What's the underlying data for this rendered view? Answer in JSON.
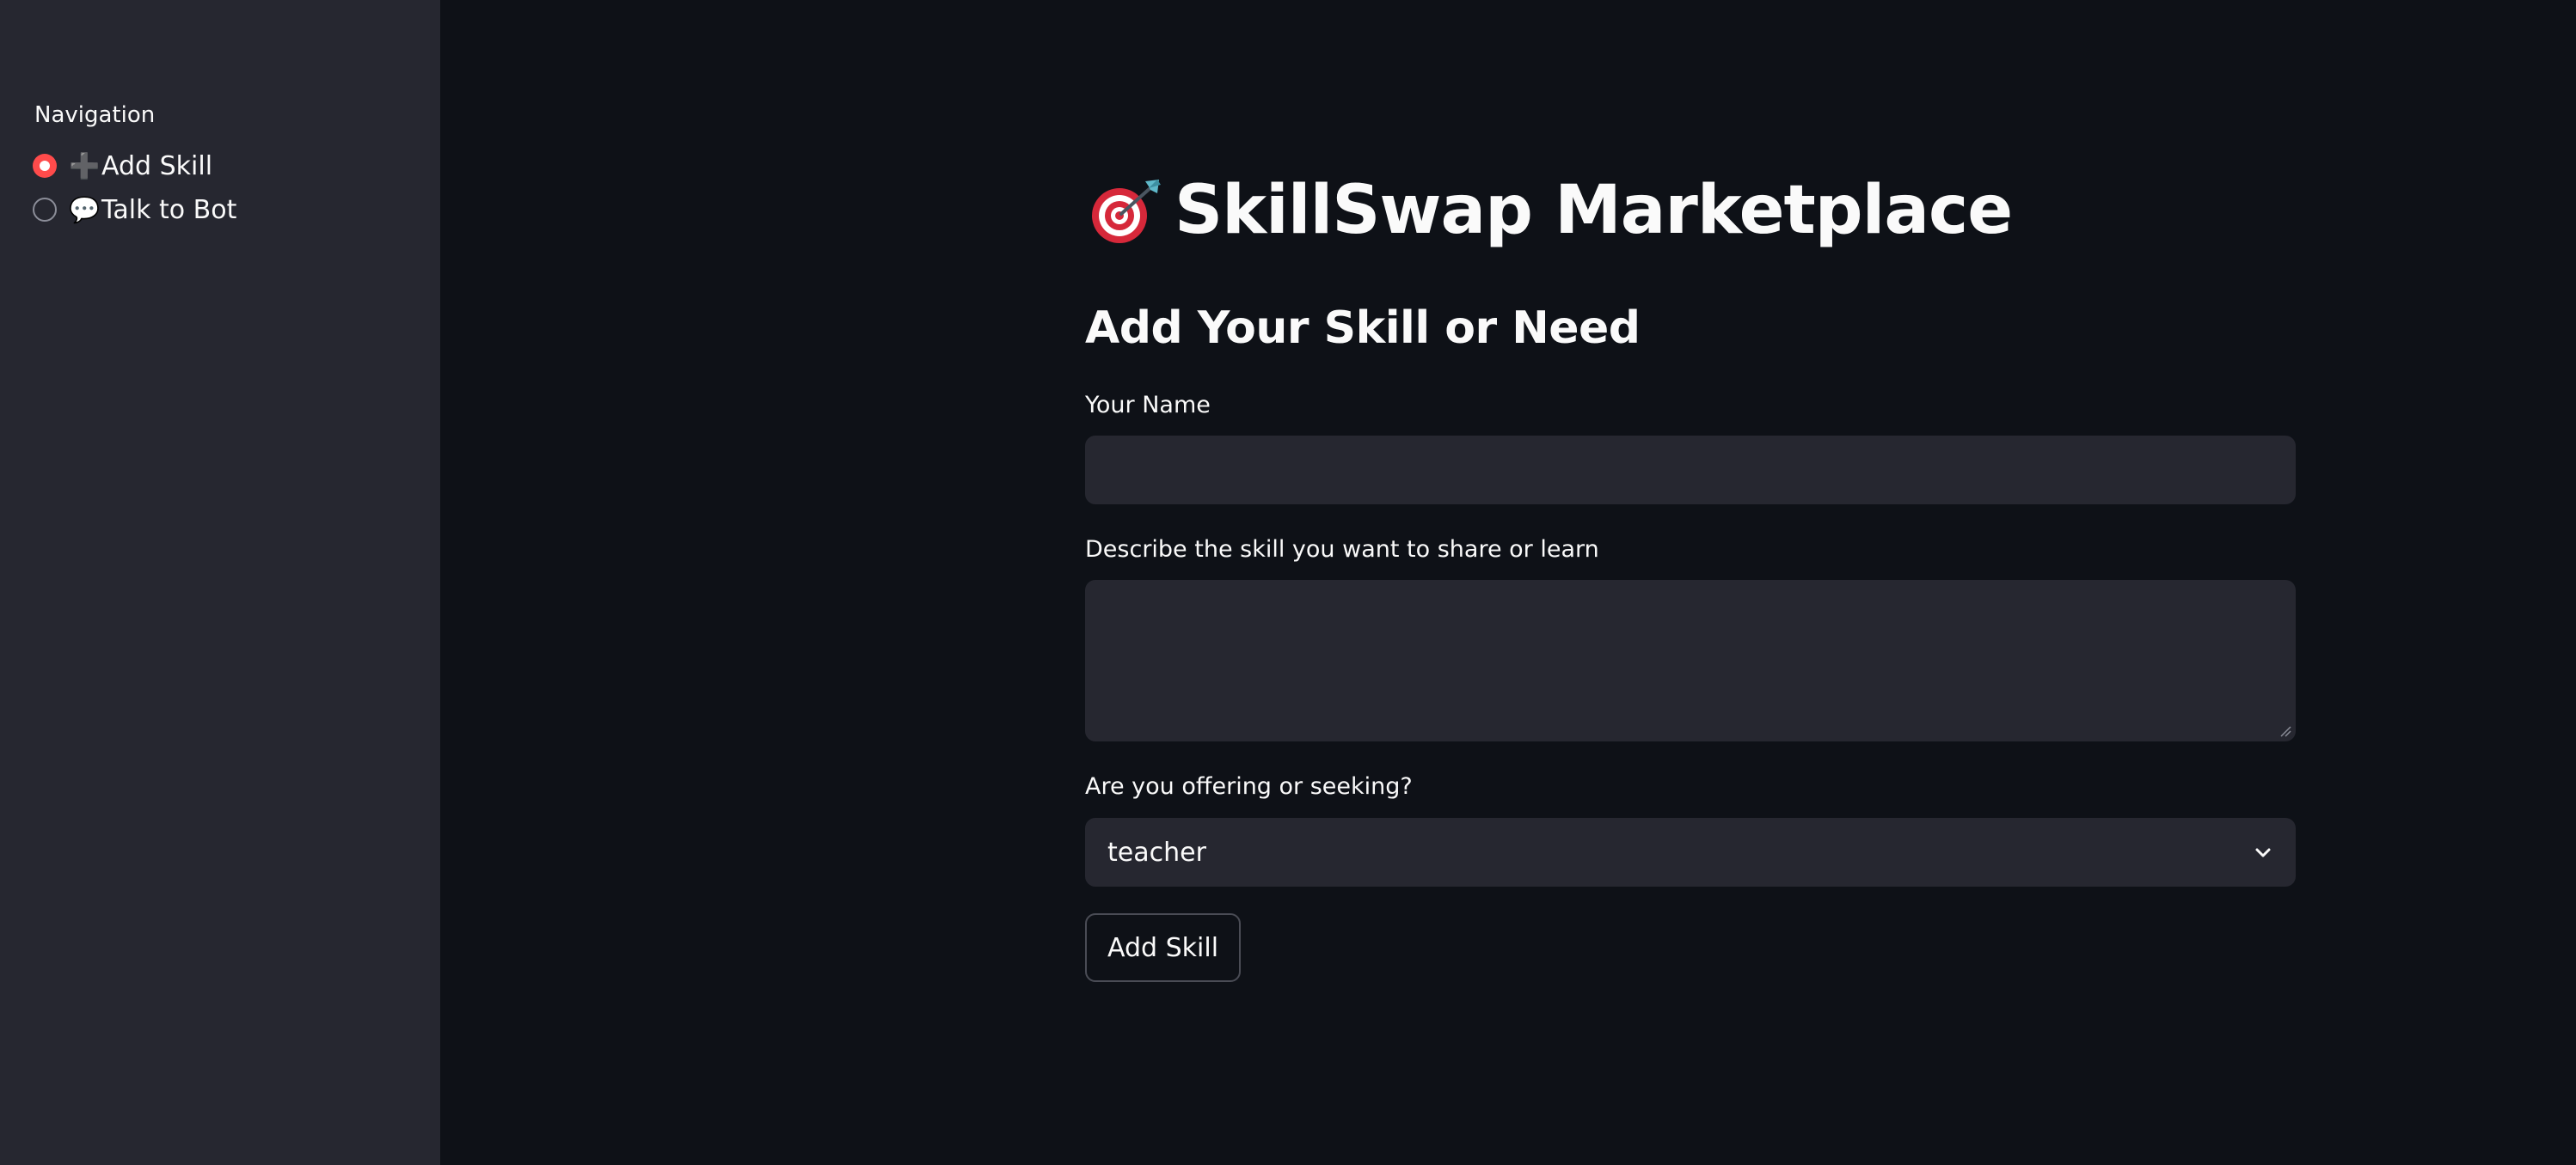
{
  "sidebar": {
    "heading": "Navigation",
    "items": [
      {
        "emoji": "➕",
        "label": "Add Skill",
        "selected": true
      },
      {
        "emoji": "💬",
        "label": "Talk to Bot",
        "selected": false
      }
    ]
  },
  "main": {
    "title": "SkillSwap Marketplace",
    "title_icon": "direct-hit-target-icon",
    "subheader": "Add Your Skill or Need",
    "name_field": {
      "label": "Your Name",
      "value": ""
    },
    "skill_field": {
      "label": "Describe the skill you want to share or learn",
      "value": ""
    },
    "role_select": {
      "label": "Are you offering or seeking?",
      "value": "teacher"
    },
    "submit_button": "Add Skill"
  },
  "colors": {
    "app_background": "#0e1117",
    "sidebar_background": "#262730",
    "input_background": "#262730",
    "accent": "#ff4b4b",
    "text": "#fafafa"
  }
}
